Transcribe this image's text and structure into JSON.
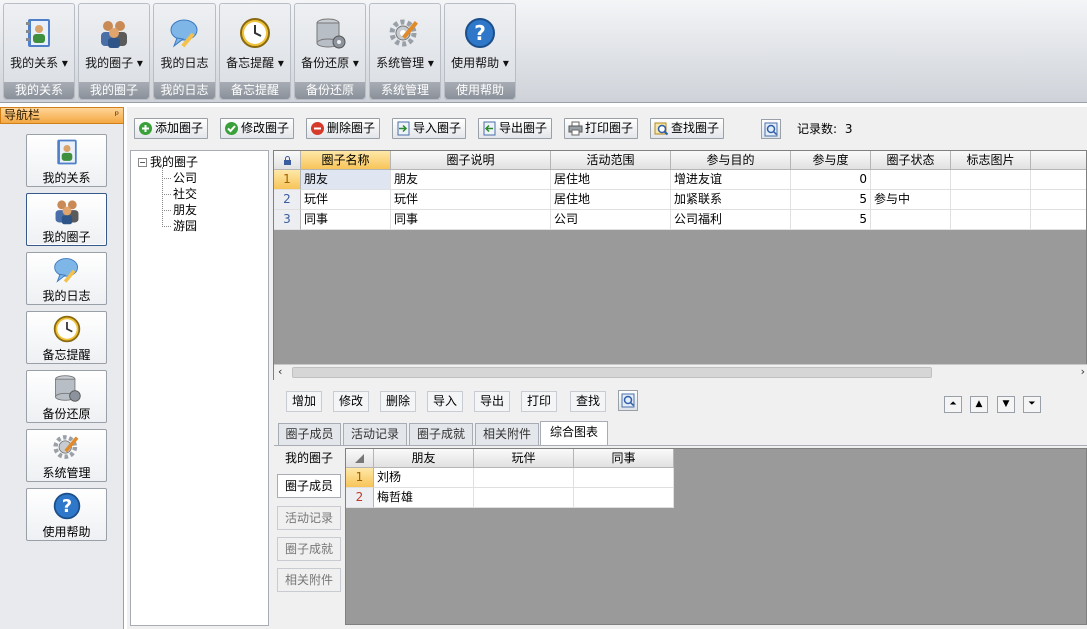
{
  "ribbon": {
    "groups": [
      {
        "label": "我的关系",
        "caption": "我的关系"
      },
      {
        "label": "我的圈子",
        "caption": "我的圈子"
      },
      {
        "label": "我的日志",
        "caption": "我的日志"
      },
      {
        "label": "备忘提醒",
        "caption": "备忘提醒"
      },
      {
        "label": "备份还原",
        "caption": "备份还原"
      },
      {
        "label": "系统管理",
        "caption": "系统管理"
      },
      {
        "label": "使用帮助",
        "caption": "使用帮助"
      }
    ]
  },
  "nav": {
    "title": "导航栏",
    "pin": "ᵖ",
    "items": [
      "我的关系",
      "我的圈子",
      "我的日志",
      "备忘提醒",
      "备份还原",
      "系统管理",
      "使用帮助"
    ]
  },
  "toolbar": {
    "add": "添加圈子",
    "edit": "修改圈子",
    "delete": "删除圈子",
    "import": "导入圈子",
    "export": "导出圈子",
    "print": "打印圈子",
    "search": "查找圈子",
    "record_label": "记录数:",
    "record_count": "3"
  },
  "tree": {
    "root": "我的圈子",
    "children": [
      "公司",
      "社交",
      "朋友",
      "游园"
    ]
  },
  "grid": {
    "columns": [
      "圈子名称",
      "圈子说明",
      "活动范围",
      "参与目的",
      "参与度",
      "圈子状态",
      "标志图片"
    ],
    "rows": [
      {
        "n": "1",
        "name": "朋友",
        "desc": "朋友",
        "scope": "居住地",
        "purpose": "增进友谊",
        "level": "0",
        "status": "",
        "img": ""
      },
      {
        "n": "2",
        "name": "玩伴",
        "desc": "玩伴",
        "scope": "居住地",
        "purpose": "加紧联系",
        "level": "5",
        "status": "参与中",
        "img": ""
      },
      {
        "n": "3",
        "name": "同事",
        "desc": "同事",
        "scope": "公司",
        "purpose": "公司福利",
        "level": "5",
        "status": "",
        "img": ""
      }
    ]
  },
  "lower_toolbar": [
    "增加",
    "修改",
    "删除",
    "导入",
    "导出",
    "打印",
    "查找"
  ],
  "tabs": [
    "圈子成员",
    "活动记录",
    "圈子成就",
    "相关附件",
    "综合图表"
  ],
  "vtabs": [
    "我的圈子",
    "圈子成员",
    "活动记录",
    "圈子成就",
    "相关附件"
  ],
  "subgrid": {
    "columns": [
      "朋友",
      "玩伴",
      "同事"
    ],
    "rows": [
      {
        "n": "1",
        "a": "刘杨",
        "b": "",
        "c": ""
      },
      {
        "n": "2",
        "a": "梅哲雄",
        "b": "",
        "c": ""
      }
    ]
  }
}
